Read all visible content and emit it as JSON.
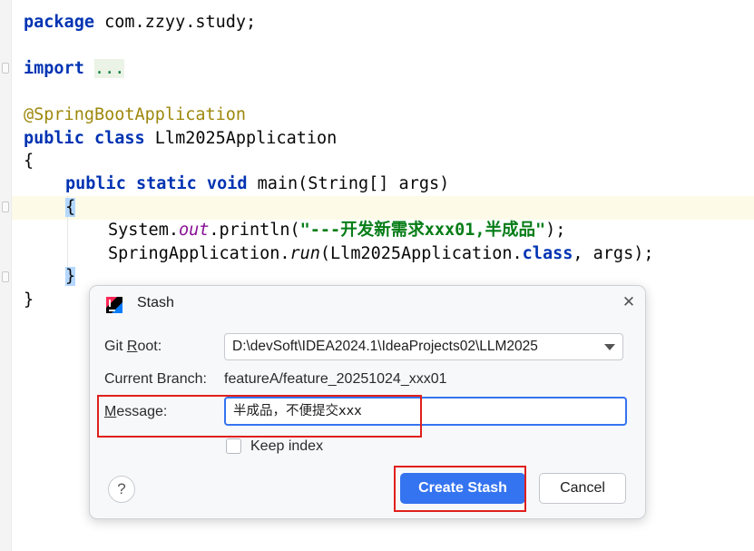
{
  "editor": {
    "line1": {
      "kw": "package",
      "rest": " com.zzyy.study;"
    },
    "line2": {
      "kw": "import",
      "fold": "..."
    },
    "line3": "@SpringBootApplication",
    "line4": {
      "kw": "public class",
      "rest": " Llm2025Application"
    },
    "line5": "{",
    "line6": {
      "kw": "public static void",
      "rest": " main(String[] args)"
    },
    "line7": "{",
    "line8": {
      "a": "System.",
      "field": "out",
      "b": ".println(",
      "str": "\"---开发新需求xxx01,半成品\"",
      "c": ");"
    },
    "line9": {
      "a": "SpringApplication.",
      "method": "run",
      "b": "(Llm2025Application.",
      "kw": "class",
      "c": ", args);"
    },
    "line10": "}",
    "line11": "}"
  },
  "dialog": {
    "title": "Stash",
    "icon": "intellij-idea-icon",
    "close_icon": "close-icon",
    "git_root_label": "Git Root:",
    "git_root_value": "D:\\devSoft\\IDEA2024.1\\IdeaProjects02\\LLM2025",
    "current_branch_label": "Current Branch:",
    "current_branch_value": "featureA/feature_20251024_xxx01",
    "message_label": "Message:",
    "message_value": "半成品，不便提交xxx",
    "keep_index_label": "Keep index",
    "keep_index_checked": false,
    "help_label": "?",
    "create_button": "Create Stash",
    "cancel_button": "Cancel"
  },
  "colors": {
    "keyword": "#0033b3",
    "annotation": "#9e880d",
    "string": "#067d17",
    "field": "#871094",
    "accent": "#3574f0",
    "highlight_box": "#e0201c"
  }
}
